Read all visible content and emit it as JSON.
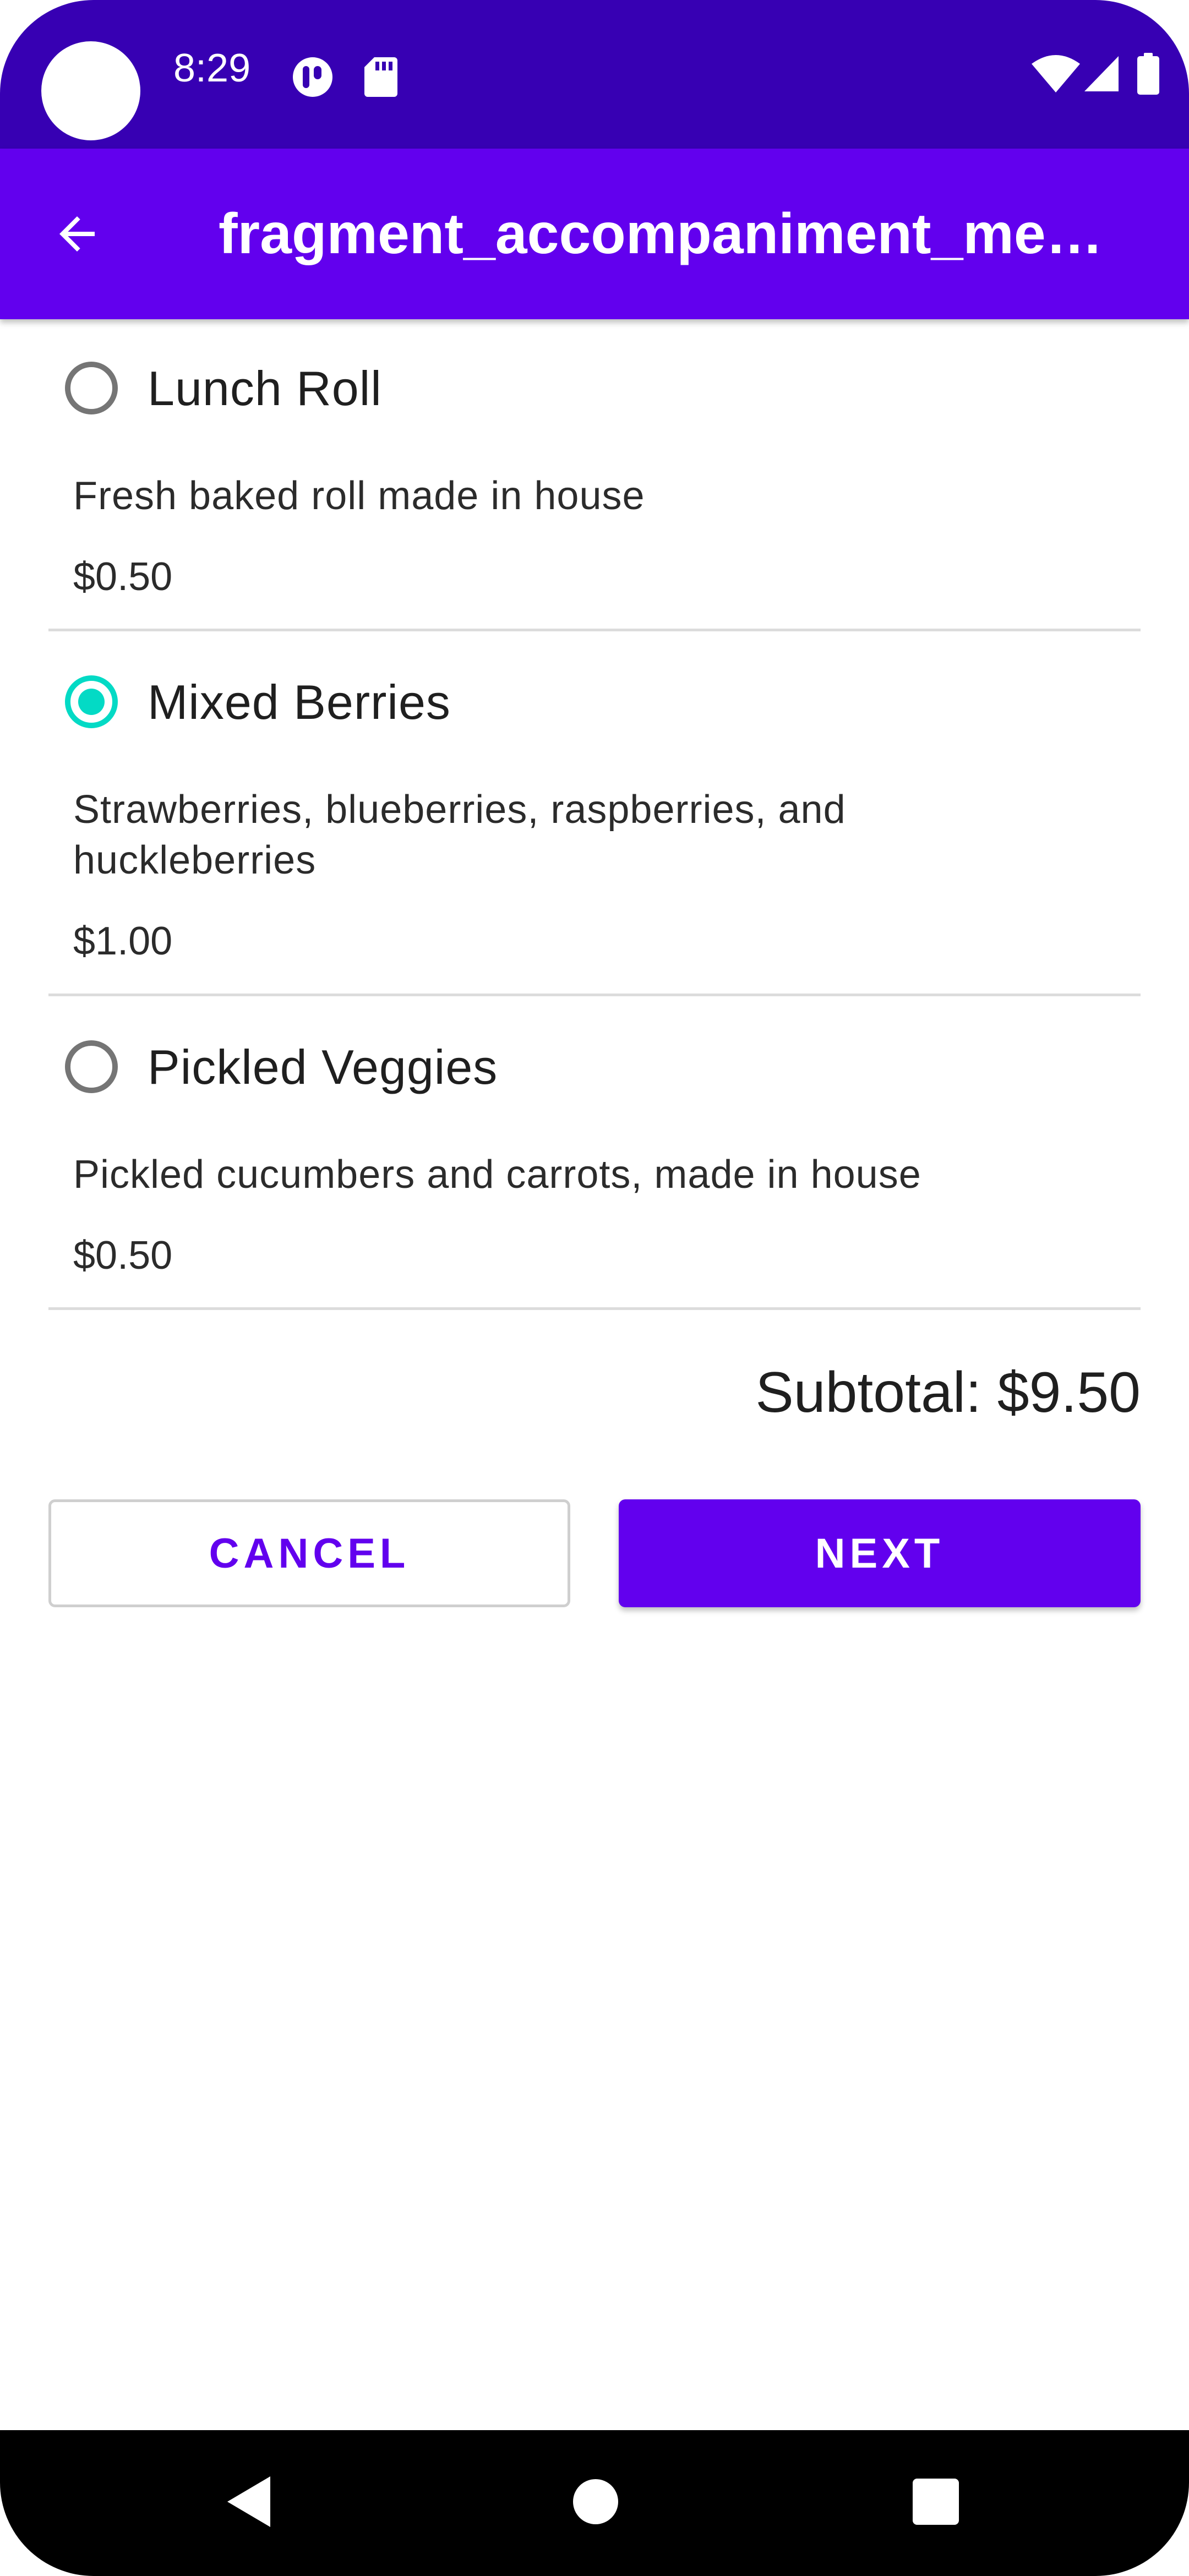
{
  "status_bar": {
    "time": "8:29",
    "icons": [
      "camera-cutout",
      "app-notification-icon",
      "sd-card-icon",
      "wifi-icon",
      "signal-icon",
      "battery-icon"
    ]
  },
  "app_bar": {
    "title": "fragment_accompaniment_me…",
    "back_icon": "arrow-back-icon"
  },
  "items": [
    {
      "name": "Lunch Roll",
      "description": "Fresh baked roll made in house",
      "price": "$0.50",
      "selected": false
    },
    {
      "name": "Mixed Berries",
      "description": "Strawberries, blueberries, raspberries, and huckleberries",
      "price": "$1.00",
      "selected": true
    },
    {
      "name": "Pickled Veggies",
      "description": "Pickled cucumbers and carrots, made in house",
      "price": "$0.50",
      "selected": false
    }
  ],
  "subtotal": "Subtotal: $9.50",
  "buttons": {
    "cancel": "CANCEL",
    "next": "NEXT"
  },
  "colors": {
    "status_bar": "#3700b3",
    "primary": "#6200ee",
    "radio_checked": "#03dac5",
    "radio_unchecked": "#757575"
  },
  "nav_bar": {
    "icons": [
      "back-triangle-icon",
      "home-circle-icon",
      "recents-square-icon"
    ]
  }
}
